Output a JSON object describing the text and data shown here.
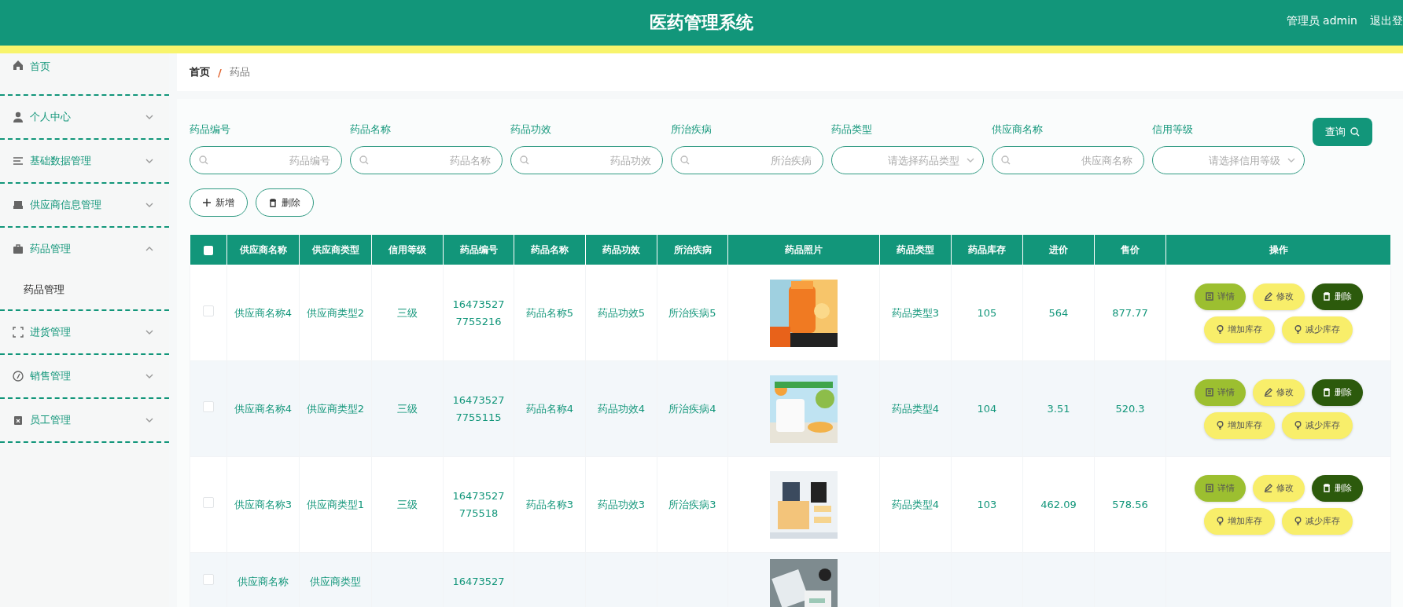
{
  "header": {
    "title": "医药管理系统",
    "user": "管理员 admin",
    "logout": "退出登"
  },
  "sidebar": {
    "items": [
      {
        "label": "首页",
        "kind": "link"
      },
      {
        "label": "个人中心",
        "kind": "menu",
        "expanded": false
      },
      {
        "label": "基础数据管理",
        "kind": "menu",
        "expanded": false
      },
      {
        "label": "供应商信息管理",
        "kind": "menu",
        "expanded": false
      },
      {
        "label": "药品管理",
        "kind": "menu",
        "expanded": true,
        "children": [
          {
            "label": "药品管理"
          }
        ]
      },
      {
        "label": "进货管理",
        "kind": "menu",
        "expanded": false
      },
      {
        "label": "销售管理",
        "kind": "menu",
        "expanded": false
      },
      {
        "label": "员工管理",
        "kind": "menu",
        "expanded": false
      }
    ]
  },
  "breadcrumb": {
    "items": [
      "首页",
      "药品"
    ],
    "separator": "/"
  },
  "search": {
    "fields": [
      {
        "label": "药品编号",
        "placeholder": "药品编号",
        "kind": "input"
      },
      {
        "label": "药品名称",
        "placeholder": "药品名称",
        "kind": "input"
      },
      {
        "label": "药品功效",
        "placeholder": "药品功效",
        "kind": "input"
      },
      {
        "label": "所治疾病",
        "placeholder": "所治疾病",
        "kind": "input"
      },
      {
        "label": "药品类型",
        "placeholder": "请选择药品类型",
        "kind": "select"
      },
      {
        "label": "供应商名称",
        "placeholder": "供应商名称",
        "kind": "input"
      },
      {
        "label": "信用等级",
        "placeholder": "请选择信用等级",
        "kind": "select"
      }
    ],
    "button": "查询"
  },
  "actions": [
    {
      "label": "新增",
      "kind": "add"
    },
    {
      "label": "删除",
      "kind": "delete"
    }
  ],
  "table": {
    "select_all_checked": false,
    "columns": [
      "供应商名称",
      "供应商类型",
      "信用等级",
      "药品编号",
      "药品名称",
      "药品功效",
      "所治疾病",
      "药品照片",
      "药品类型",
      "药品库存",
      "进价",
      "售价",
      "操作"
    ],
    "rows": [
      {
        "checked": false,
        "cells": [
          "供应商名称4",
          "供应商类型2",
          "三级",
          "164735277755216",
          "药品名称5",
          "药品功效5",
          "所治疾病5",
          {
            "kind": "picture"
          },
          "药品类型3",
          "105",
          "564",
          "877.77"
        ],
        "buttons": [
          {
            "label": "详情",
            "kind": "detail"
          },
          {
            "label": "修改",
            "kind": "edit"
          },
          {
            "label": "删除",
            "kind": "delete"
          },
          {
            "label": "增加库存",
            "kind": "stock"
          },
          {
            "label": "减少库存",
            "kind": "stock"
          }
        ]
      },
      {
        "checked": false,
        "cells": [
          "供应商名称4",
          "供应商类型2",
          "三级",
          "164735277755115",
          "药品名称4",
          "药品功效4",
          "所治疾病4",
          {
            "kind": "picture"
          },
          "药品类型4",
          "104",
          "3.51",
          "520.3"
        ],
        "buttons": [
          {
            "label": "详情",
            "kind": "detail"
          },
          {
            "label": "修改",
            "kind": "edit"
          },
          {
            "label": "删除",
            "kind": "delete"
          },
          {
            "label": "增加库存",
            "kind": "stock"
          },
          {
            "label": "减少库存",
            "kind": "stock"
          }
        ]
      },
      {
        "checked": false,
        "cells": [
          "供应商名称3",
          "供应商类型1",
          "三级",
          "16473527775518",
          "药品名称3",
          "药品功效3",
          "所治疾病3",
          {
            "kind": "picture"
          },
          "药品类型4",
          "103",
          "462.09",
          "578.56"
        ],
        "buttons": [
          {
            "label": "详情",
            "kind": "detail"
          },
          {
            "label": "修改",
            "kind": "edit"
          },
          {
            "label": "删除",
            "kind": "delete"
          },
          {
            "label": "增加库存",
            "kind": "stock"
          },
          {
            "label": "减少库存",
            "kind": "stock"
          }
        ]
      },
      {
        "checked": false,
        "cells": [
          "供应商名称",
          "供应商类型",
          "",
          "16473527",
          "",
          "",
          "",
          {
            "kind": "picture"
          },
          "",
          "",
          "",
          ""
        ]
      }
    ]
  }
}
